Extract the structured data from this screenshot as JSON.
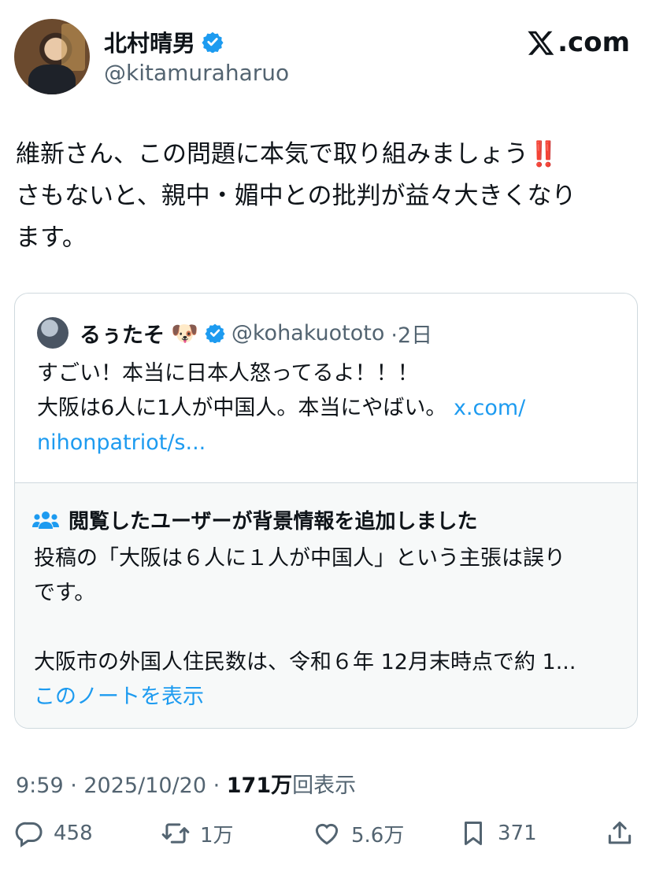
{
  "author": {
    "name": "北村晴男",
    "handle": "@kitamuraharuo",
    "verified_icon": "verified-badge-icon"
  },
  "site": {
    "label": ".com",
    "logo_icon": "x-logo-icon"
  },
  "post": {
    "lines": [
      "維新さん、この問題に本気で取り組みましょう",
      "さもないと、親中・媚中との批判が益々大きくなり",
      "ます。"
    ],
    "emphasis": "‼️"
  },
  "quote": {
    "name": "るぅたそ",
    "emoji": "🐶",
    "handle": "@kohakuototo",
    "time": "·2日",
    "line1": "すごい！本当に日本人怒ってるよ！！！",
    "line2": "大阪は6人に1人が中国人。本当にやばい。",
    "link_part1": "x.com/",
    "link_part2": "nihonpatriot/s..."
  },
  "note": {
    "title": "閲覧したユーザーが背景情報を追加しました",
    "line1": "投稿の「大阪は６人に１人が中国人」という主張は誤り",
    "line2": "です。",
    "line3": "大阪市の外国人住民数は、令和６年 12月末時点で約 1...",
    "show_link": "このノートを表示"
  },
  "meta": {
    "time": "9:59 · 2025/10/20 · ",
    "views_count": "171万",
    "views_label": "回表示"
  },
  "actions": {
    "replies": "458",
    "reposts": "1万",
    "likes": "5.6万",
    "bookmarks": "371"
  },
  "colors": {
    "text": "#0f1419",
    "secondary": "#536471",
    "link": "#1d9bf0",
    "verified": "#1d9bf0",
    "border": "#cfd9de",
    "note_bg": "#f7f9f9"
  }
}
